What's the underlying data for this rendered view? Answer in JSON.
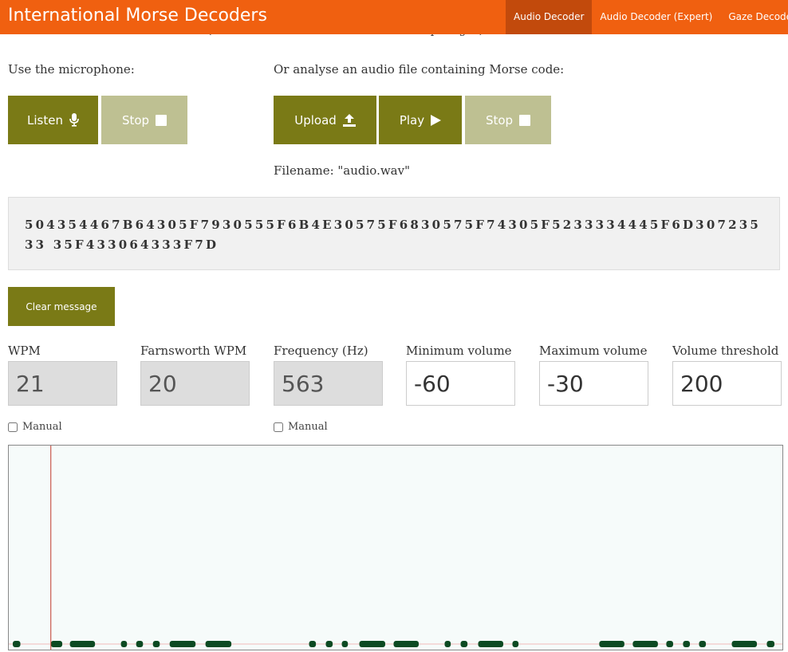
{
  "navbar": {
    "brand": "International Morse Decoders",
    "links": [
      {
        "label": "Audio Decoder",
        "active": true
      },
      {
        "label": "Audio Decoder (Expert)",
        "active": false
      },
      {
        "label": "Gaze Decoder",
        "active": false
      }
    ]
  },
  "intro": {
    "partial_text": "(and includes accented characters and prosigns)."
  },
  "microphone": {
    "label": "Use the microphone:",
    "listen_label": "Listen",
    "stop_label": "Stop"
  },
  "file": {
    "label": "Or analyse an audio file containing Morse code:",
    "upload_label": "Upload",
    "play_label": "Play",
    "stop_label": "Stop",
    "filename_text": "Filename: \"audio.wav\""
  },
  "message": {
    "text": "504354467B64305F7930555F6B4E30575F6830575F74305F5233334445F6D30723533 35F433064333F7D"
  },
  "clear_button_label": "Clear message",
  "fields": {
    "wpm": {
      "label": "WPM",
      "value": "21"
    },
    "farnsworth": {
      "label": "Farnsworth WPM",
      "value": "20"
    },
    "frequency": {
      "label": "Frequency (Hz)",
      "value": "563"
    },
    "min_volume": {
      "label": "Minimum volume",
      "value": "-60"
    },
    "max_volume": {
      "label": "Maximum volume",
      "value": "-30"
    },
    "threshold": {
      "label": "Volume threshold",
      "value": "200"
    }
  },
  "manual_label_1": "Manual",
  "manual_label_2": "Manual",
  "colors": {
    "navbar": "#f06010",
    "navbar_active": "#c24a0c",
    "button_primary": "#7a7a16",
    "button_disabled": "#bec092",
    "signal_mark": "#0c4a22",
    "cursor_line": "#c0392b"
  },
  "visualizer": {
    "segments": [
      [
        0.0,
        0.01
      ],
      [
        0.05,
        0.065
      ],
      [
        0.075,
        0.108
      ],
      [
        0.142,
        0.15
      ],
      [
        0.162,
        0.171
      ],
      [
        0.184,
        0.193
      ],
      [
        0.206,
        0.24
      ],
      [
        0.253,
        0.287
      ],
      [
        0.389,
        0.398
      ],
      [
        0.411,
        0.42
      ],
      [
        0.432,
        0.44
      ],
      [
        0.455,
        0.489
      ],
      [
        0.5,
        0.533
      ],
      [
        0.567,
        0.575
      ],
      [
        0.588,
        0.597
      ],
      [
        0.611,
        0.644
      ],
      [
        0.656,
        0.664
      ],
      [
        0.77,
        0.803
      ],
      [
        0.814,
        0.847
      ],
      [
        0.858,
        0.867
      ],
      [
        0.88,
        0.889
      ],
      [
        0.901,
        0.91
      ],
      [
        0.944,
        0.977
      ],
      [
        0.99,
        1.0
      ]
    ],
    "cursor_fraction": 0.05
  }
}
